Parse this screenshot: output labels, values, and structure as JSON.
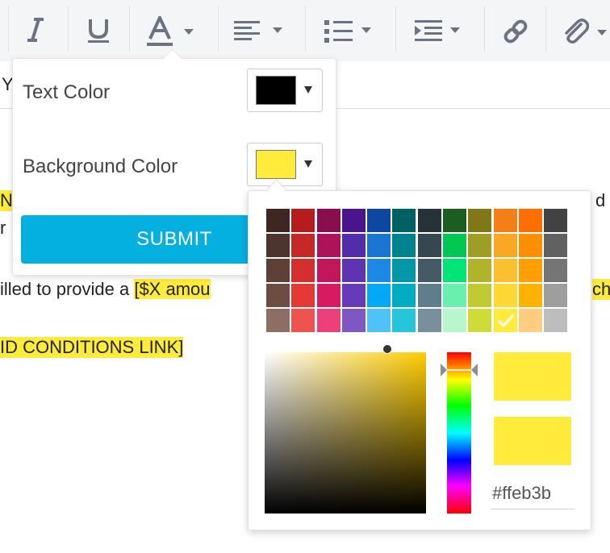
{
  "toolbar": {
    "buttons": [
      {
        "name": "italic",
        "icon": "italic-icon"
      },
      {
        "name": "underline",
        "icon": "underline-icon"
      },
      {
        "name": "text-color",
        "icon": "font-color-icon"
      },
      {
        "name": "align",
        "icon": "align-left-icon"
      },
      {
        "name": "list",
        "icon": "bullet-list-icon"
      },
      {
        "name": "indent",
        "icon": "indent-icon"
      },
      {
        "name": "link",
        "icon": "link-icon"
      },
      {
        "name": "attach",
        "icon": "paperclip-icon"
      }
    ]
  },
  "editor": {
    "line1_start": "Y",
    "line2_start": "N",
    "line2_end": "d",
    "line3_start": "r",
    "line4_text": "illed to provide a ",
    "line4_highlight": "[$X amou",
    "line4_end": "ch",
    "line5_highlight": "ID CONDITIONS LINK]"
  },
  "color_popover": {
    "text_color_label": "Text Color",
    "text_color_value": "#000000",
    "background_color_label": "Background Color",
    "background_color_value": "#ffeb3b",
    "submit_label": "SUBMIT"
  },
  "color_picker": {
    "palette": [
      [
        "#3e2723",
        "#b71c1c",
        "#880e4f",
        "#4a148c",
        "#0d47a1",
        "#006064",
        "#263238",
        "#1b5e20",
        "#827717",
        "#f57f17",
        "#ff6f00",
        "#424242"
      ],
      [
        "#4e342e",
        "#c62828",
        "#ad1457",
        "#512da8",
        "#1976d2",
        "#00838f",
        "#37474f",
        "#00c853",
        "#9e9d24",
        "#f9a825",
        "#ff8f00",
        "#616161"
      ],
      [
        "#5d4037",
        "#d32f2f",
        "#c2185b",
        "#5e35b1",
        "#1e88e5",
        "#0097a7",
        "#455a64",
        "#00e676",
        "#afb42b",
        "#fbc02d",
        "#ffa000",
        "#757575"
      ],
      [
        "#6d4c41",
        "#e53935",
        "#d81b60",
        "#673ab7",
        "#03a9f4",
        "#00acc1",
        "#607d8b",
        "#69f0ae",
        "#c0ca33",
        "#fdd835",
        "#ffb300",
        "#9e9e9e"
      ],
      [
        "#8d6e63",
        "#ef5350",
        "#ec407a",
        "#7e57c2",
        "#4fc3f7",
        "#26c6da",
        "#78909c",
        "#b9f6ca",
        "#cddc39",
        "#ffeb3b",
        "#ffcc80",
        "#bdbdbd"
      ]
    ],
    "selected_color": "#ffeb3b",
    "hue_base": "#ffcc00",
    "current_color": "#ffeb3b",
    "previous_color": "#ffeb3b",
    "hex_value": "#ffeb3b"
  }
}
